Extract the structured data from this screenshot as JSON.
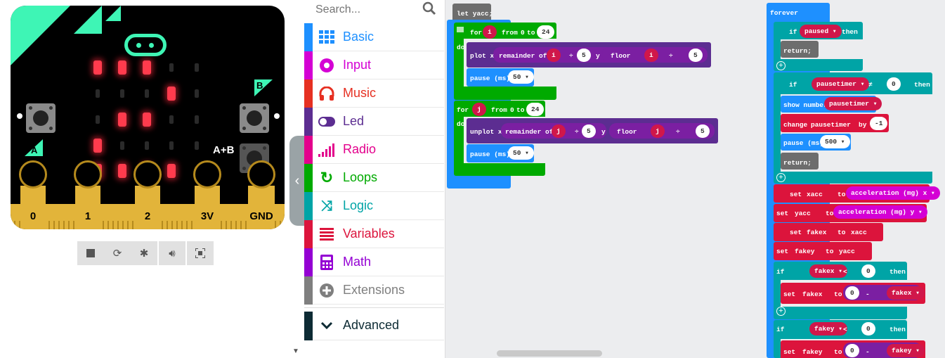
{
  "simulator": {
    "button_a_label": "A",
    "button_b_label": "B",
    "button_ab_label": "A+B",
    "pins": [
      "0",
      "1",
      "2",
      "3V",
      "GND"
    ],
    "leds": [
      [
        1,
        1,
        1,
        0,
        0
      ],
      [
        0,
        0,
        0,
        1,
        0
      ],
      [
        0,
        1,
        1,
        0,
        0
      ],
      [
        1,
        0,
        0,
        0,
        0
      ],
      [
        1,
        1,
        1,
        1,
        0
      ]
    ],
    "toolbar_icons": [
      "stop-icon",
      "restart-icon",
      "debug-icon",
      "mute-icon",
      "fullscreen-icon"
    ]
  },
  "toolbox": {
    "search_placeholder": "Search...",
    "categories": [
      {
        "label": "Basic",
        "color": "#1e90ff",
        "icon": "grid-icon"
      },
      {
        "label": "Input",
        "color": "#d400d4",
        "icon": "circle-icon"
      },
      {
        "label": "Music",
        "color": "#e63022",
        "icon": "headphones-icon"
      },
      {
        "label": "Led",
        "color": "#5c2d91",
        "icon": "toggle-icon"
      },
      {
        "label": "Radio",
        "color": "#e3008c",
        "icon": "signal-icon"
      },
      {
        "label": "Loops",
        "color": "#00aa00",
        "icon": "refresh-icon"
      },
      {
        "label": "Logic",
        "color": "#00a4a6",
        "icon": "shuffle-icon"
      },
      {
        "label": "Variables",
        "color": "#dc143c",
        "icon": "list-icon"
      },
      {
        "label": "Math",
        "color": "#9400d3",
        "icon": "calculator-icon"
      },
      {
        "label": "Extensions",
        "color": "#7f7f7f",
        "icon": "plus-circle-icon"
      }
    ],
    "advanced_label": "Advanced"
  },
  "workspace": {
    "let_yacc": "let yacc;",
    "for": "for",
    "from": "from",
    "to": "to",
    "do": "do",
    "var_i": "i",
    "var_j": "j",
    "zero": "0",
    "twentyfour": "24",
    "plot_x": "plot x",
    "unplot_x": "unplot x",
    "remainder_of": "remainder of",
    "div": "÷",
    "five": "5",
    "y": "y",
    "floor": "floor",
    "pause_ms": "pause (ms)",
    "fifty": "50",
    "forever": "forever",
    "if": "if",
    "then": "then",
    "paused": "paused",
    "return": "return;",
    "pausetimer": "pausetimer",
    "neq": "≠",
    "show_number": "show number",
    "change": "change",
    "by": "by",
    "minus_one": "-1",
    "five_hundred": "500",
    "set": "set",
    "xacc": "xacc",
    "yacc": "yacc",
    "accel_x": "acceleration (mg)  x",
    "accel_y": "acceleration (mg)  y",
    "fakex": "fakex",
    "fakey": "fakey",
    "lt": "<",
    "minus": "-"
  }
}
